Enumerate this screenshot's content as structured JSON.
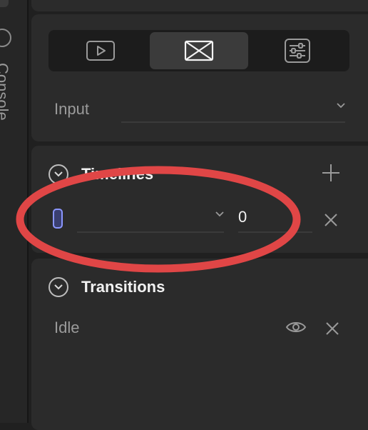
{
  "left_rail": {
    "label": "Console"
  },
  "view_switch": {
    "buttons": [
      {
        "icon": "play-square-icon",
        "active": false
      },
      {
        "icon": "bowtie-icon",
        "active": true
      },
      {
        "icon": "sliders-icon",
        "active": false
      }
    ]
  },
  "input": {
    "label": "Input",
    "value": ""
  },
  "timelines": {
    "title": "Timelines",
    "row": {
      "selected": "",
      "value": "0"
    }
  },
  "transitions": {
    "title": "Transitions",
    "row": {
      "label": "Idle"
    }
  },
  "annotation": {
    "color": "#e04646"
  },
  "colors": {
    "accent": "#8b96ff",
    "background": "#202020",
    "panel": "#2b2b2b"
  }
}
